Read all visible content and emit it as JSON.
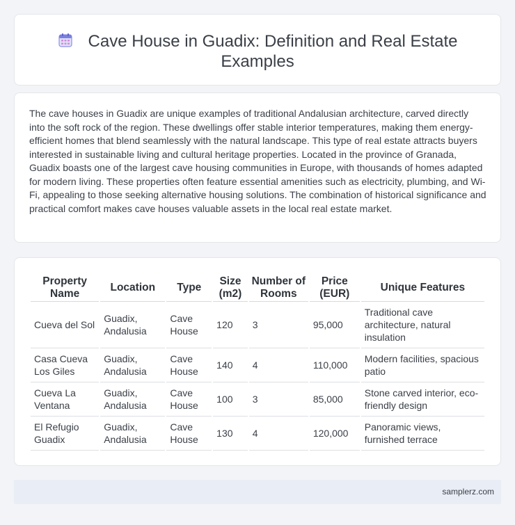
{
  "header": {
    "title_line1": "Cave House in Guadix: Definition and Real Estate",
    "title_line2": "Examples",
    "icon": "calendar-icon"
  },
  "description": "The cave houses in Guadix are unique examples of traditional Andalusian architecture, carved directly into the soft rock of the region. These dwellings offer stable interior temperatures, making them energy-efficient homes that blend seamlessly with the natural landscape. This type of real estate attracts buyers interested in sustainable living and cultural heritage properties. Located in the province of Granada, Guadix boasts one of the largest cave housing communities in Europe, with thousands of homes adapted for modern living. These properties often feature essential amenities such as electricity, plumbing, and Wi-Fi, appealing to those seeking alternative housing solutions. The combination of historical significance and practical comfort makes cave houses valuable assets in the local real estate market.",
  "table": {
    "headers": [
      "Property Name",
      "Location",
      "Type",
      "Size (m2)",
      "Number of Rooms",
      "Price (EUR)",
      "Unique Features"
    ],
    "rows": [
      [
        "Cueva del Sol",
        "Guadix, Andalusia",
        "Cave House",
        "120",
        "3",
        "95,000",
        "Traditional cave architecture, natural insulation"
      ],
      [
        "Casa Cueva Los Giles",
        "Guadix, Andalusia",
        "Cave House",
        "140",
        "4",
        "110,000",
        "Modern facilities, spacious patio"
      ],
      [
        "Cueva La Ventana",
        "Guadix, Andalusia",
        "Cave House",
        "100",
        "3",
        "85,000",
        "Stone carved interior, eco-friendly design"
      ],
      [
        "El Refugio Guadix",
        "Guadix, Andalusia",
        "Cave House",
        "130",
        "4",
        "120,000",
        "Panoramic views, furnished terrace"
      ]
    ]
  },
  "footer": {
    "site": "samplerz.com"
  },
  "colors": {
    "accent_icon": "#7b7fe0",
    "background": "#f3f4f7",
    "footer_bg": "#e9edf5"
  }
}
